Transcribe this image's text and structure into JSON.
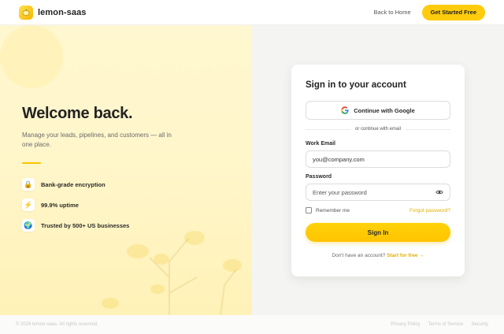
{
  "header": {
    "brand_name": "lemon-saas",
    "back_link": "Back to Home",
    "cta_label": "Get Started Free"
  },
  "left": {
    "title": "Welcome back.",
    "subtitle": "Manage your leads, pipelines, and customers — all in one place.",
    "features": [
      {
        "icon": "🔒",
        "icon_name": "lock-icon",
        "label": "Bank-grade encryption"
      },
      {
        "icon": "⚡",
        "icon_name": "lightning-icon",
        "label": "99.9% uptime"
      },
      {
        "icon": "🌍",
        "icon_name": "globe-icon",
        "label": "Trusted by 500+ US businesses"
      }
    ]
  },
  "card": {
    "title": "Sign in to your account",
    "google_label": "Continue with Google",
    "or_text": "or continue with email",
    "email_label": "Work Email",
    "email_value": "you@company.com",
    "password_label": "Password",
    "password_placeholder": "Enter your password",
    "remember_label": "Remember me",
    "forgot_label": "Forgot password?",
    "signin_label": "Sign In",
    "signup_prompt": "Don't have an account?",
    "signup_link": "Start for free →"
  },
  "footer": {
    "copyright": "© 2026 lemon-saas. All rights reserved.",
    "links": [
      "Privacy Policy",
      "Terms of Service",
      "Security"
    ]
  },
  "colors": {
    "accent": "#ffcc0d",
    "link": "#e0b000",
    "left_bg": "#fff6cc"
  }
}
